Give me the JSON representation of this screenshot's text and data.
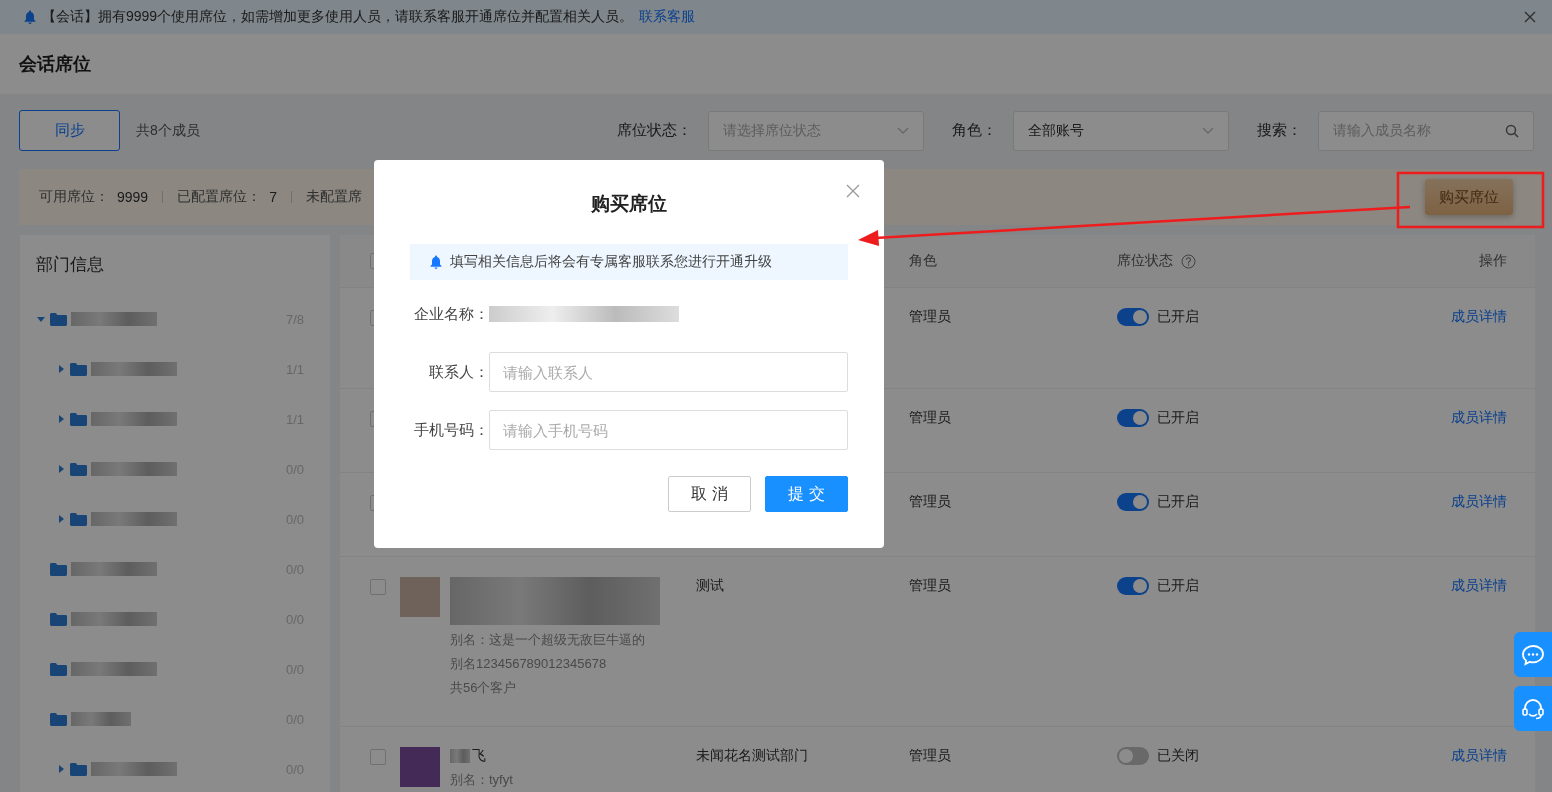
{
  "notice": {
    "text": "【会话】拥有9999个使用席位，如需增加更多使用人员，请联系客服开通席位并配置相关人员。",
    "link": "联系客服"
  },
  "page_title": "会话席位",
  "toolbar": {
    "sync_button": "同步",
    "member_count": "共8个成员",
    "filters": [
      {
        "label": "席位状态：",
        "kind": "select",
        "placeholder": "请选择席位状态"
      },
      {
        "label": "角色：",
        "kind": "select",
        "value": "全部账号"
      },
      {
        "label": "搜索：",
        "kind": "search",
        "placeholder": "请输入成员名称"
      }
    ]
  },
  "stats": {
    "items": [
      {
        "label": "可用席位：",
        "value": "9999"
      },
      {
        "label": "已配置席位：",
        "value": "7"
      },
      {
        "label": "未配置席"
      }
    ],
    "buy_button": "购买席位"
  },
  "sidebar": {
    "title": "部门信息",
    "tree": [
      {
        "count": "7/8",
        "expanded": true,
        "children": [
          {
            "count": "1/1",
            "expanded": false
          },
          {
            "count": "1/1",
            "expanded": false
          },
          {
            "count": "0/0",
            "expanded": false
          },
          {
            "count": "0/0",
            "expanded": false
          }
        ]
      },
      {
        "count": "0/0"
      },
      {
        "count": "0/0"
      },
      {
        "count": "0/0"
      },
      {
        "count": "0/0",
        "children": [
          {
            "count": "0/0",
            "expanded": false
          }
        ]
      }
    ]
  },
  "table": {
    "select_all": {
      "checked": false
    },
    "columns": [
      "角色",
      "席位状态",
      "操作"
    ],
    "rows": [
      {
        "checked": false,
        "role": "管理员",
        "seat_on": true,
        "status": "已开启",
        "action": "成员详情"
      },
      {
        "checked": false,
        "role": "管理员",
        "seat_on": true,
        "status": "已开启",
        "action": "成员详情"
      },
      {
        "checked": false,
        "role": "管理员",
        "seat_on": true,
        "status": "已开启",
        "action": "成员详情"
      },
      {
        "checked": false,
        "notes": [
          "别名：这是一个超级无敌巨牛逼的",
          "别名123456789012345678",
          "共56个客户"
        ],
        "department": "测试",
        "role": "管理员",
        "seat_on": true,
        "status": "已开启",
        "action": "成员详情"
      },
      {
        "checked": false,
        "name_visible": "飞",
        "notes": [
          "别名：tyfyt"
        ],
        "department": "未闻花名测试部门",
        "role": "管理员",
        "seat_on": false,
        "status": "已关闭",
        "action": "成员详情"
      }
    ]
  },
  "dialog": {
    "title": "购买席位",
    "tip": "填写相关信息后将会有专属客服联系您进行开通升级",
    "fields": [
      {
        "label": "企业名称：",
        "kind": "readonly"
      },
      {
        "label": "联系人：",
        "kind": "input",
        "placeholder": "请输入联系人"
      },
      {
        "label": "手机号码：",
        "kind": "input",
        "placeholder": "请输入手机号码"
      }
    ],
    "buttons": [
      {
        "label": "取 消",
        "kind": "default"
      },
      {
        "label": "提 交",
        "kind": "primary"
      }
    ]
  }
}
